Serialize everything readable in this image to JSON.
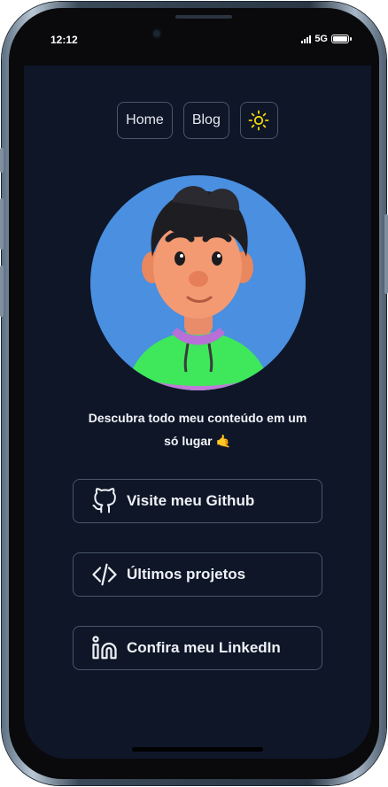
{
  "status_bar": {
    "time": "12:12",
    "network": "5G"
  },
  "nav": {
    "home_label": "Home",
    "blog_label": "Blog",
    "theme_icon": "sun-icon"
  },
  "profile": {
    "avatar_icon": "cartoon-avatar"
  },
  "tagline": {
    "line1": "Descubra todo meu conteúdo em um",
    "line2": "só lugar 🤙"
  },
  "links": [
    {
      "label": "Visite meu Github",
      "icon": "github-icon"
    },
    {
      "label": "Últimos projetos",
      "icon": "code-icon"
    },
    {
      "label": "Confira meu LinkedIn",
      "icon": "linkedin-icon"
    }
  ],
  "colors": {
    "background": "#0e1628",
    "border": "#4a5568",
    "sun": "#f5d90a",
    "avatar_bg": "#4a8fe0"
  }
}
